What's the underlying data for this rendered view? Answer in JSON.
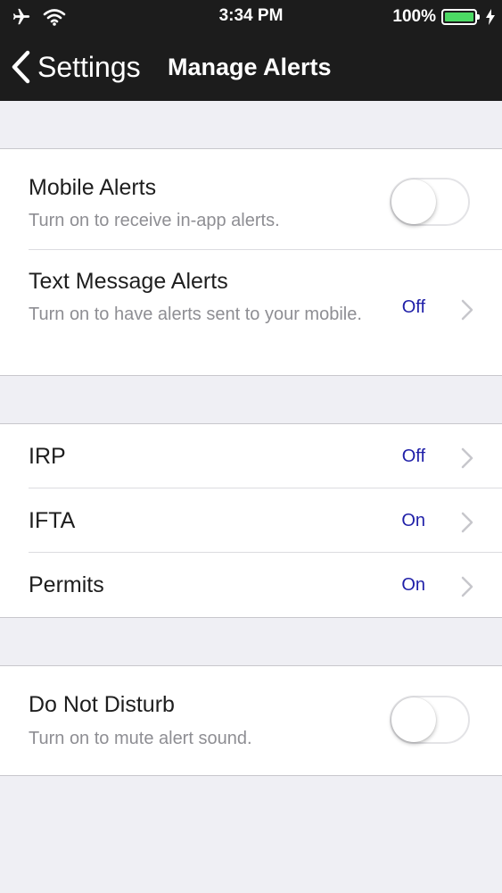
{
  "status_bar": {
    "time": "3:34 PM",
    "battery_percent": "100%",
    "icons": [
      "airplane-icon",
      "wifi-icon",
      "battery-icon",
      "charging-bolt-icon"
    ]
  },
  "nav": {
    "back_label": "Settings",
    "title": "Manage Alerts"
  },
  "alerts": {
    "mobile": {
      "title": "Mobile Alerts",
      "subtitle": "Turn on to receive in-app alerts.",
      "enabled": false
    },
    "text_message": {
      "title": "Text Message Alerts",
      "subtitle": "Turn on to have alerts sent to your mobile.",
      "value": "Off"
    }
  },
  "programs": [
    {
      "title": "IRP",
      "value": "Off"
    },
    {
      "title": "IFTA",
      "value": "On"
    },
    {
      "title": "Permits",
      "value": "On"
    }
  ],
  "do_not_disturb": {
    "title": "Do Not Disturb",
    "subtitle": "Turn on to mute alert sound.",
    "enabled": false
  },
  "colors": {
    "header_bg": "#1c1c1c",
    "page_bg": "#efeff4",
    "value_text": "#1f1fa8",
    "battery": "#4cd964"
  }
}
